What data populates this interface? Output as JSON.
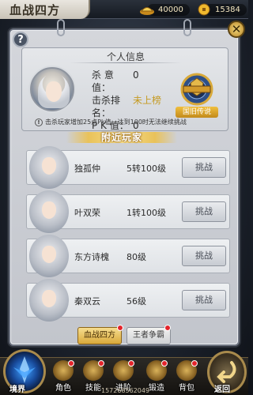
{
  "header": {
    "title": "血战四方",
    "currency1": "40000",
    "currency2": "15384",
    "currency1_icon": "ingot-icon",
    "currency2_icon": "gold-coin-icon"
  },
  "panel": {
    "help_label": "?",
    "close_label": "✕"
  },
  "personal_info": {
    "title": "个人信息",
    "kill_label": "杀 意 值：",
    "kill_value": "0",
    "rank_label": "击杀排名：",
    "rank_value": "未上榜",
    "pk_label": "P K 值：",
    "pk_value": "0",
    "rank_badge_label": "国旧传说",
    "notice": "击杀玩家增加25点Pk值，达到100时无法继续挑战"
  },
  "nearby": {
    "title": "附近玩家",
    "challenge_label": "挑战",
    "players": [
      {
        "name": "独孤仲",
        "level": "5转100级"
      },
      {
        "name": "叶双荣",
        "level": "1转100级"
      },
      {
        "name": "东方诗槐",
        "level": "80级"
      },
      {
        "name": "秦双云",
        "level": "56级"
      }
    ]
  },
  "tabs": [
    {
      "label": "血战四方",
      "active": true
    },
    {
      "label": "王者争霸",
      "active": false
    }
  ],
  "bottom_nav": {
    "realm": "境界",
    "items": [
      "角色",
      "技能",
      "进阶",
      "锻造",
      "背包"
    ],
    "back": "返回",
    "footer_id": "157268562049"
  },
  "colors": {
    "accent_gold": "#d9a93b",
    "rank_value": "#c59a22",
    "notification": "#e3242b"
  }
}
